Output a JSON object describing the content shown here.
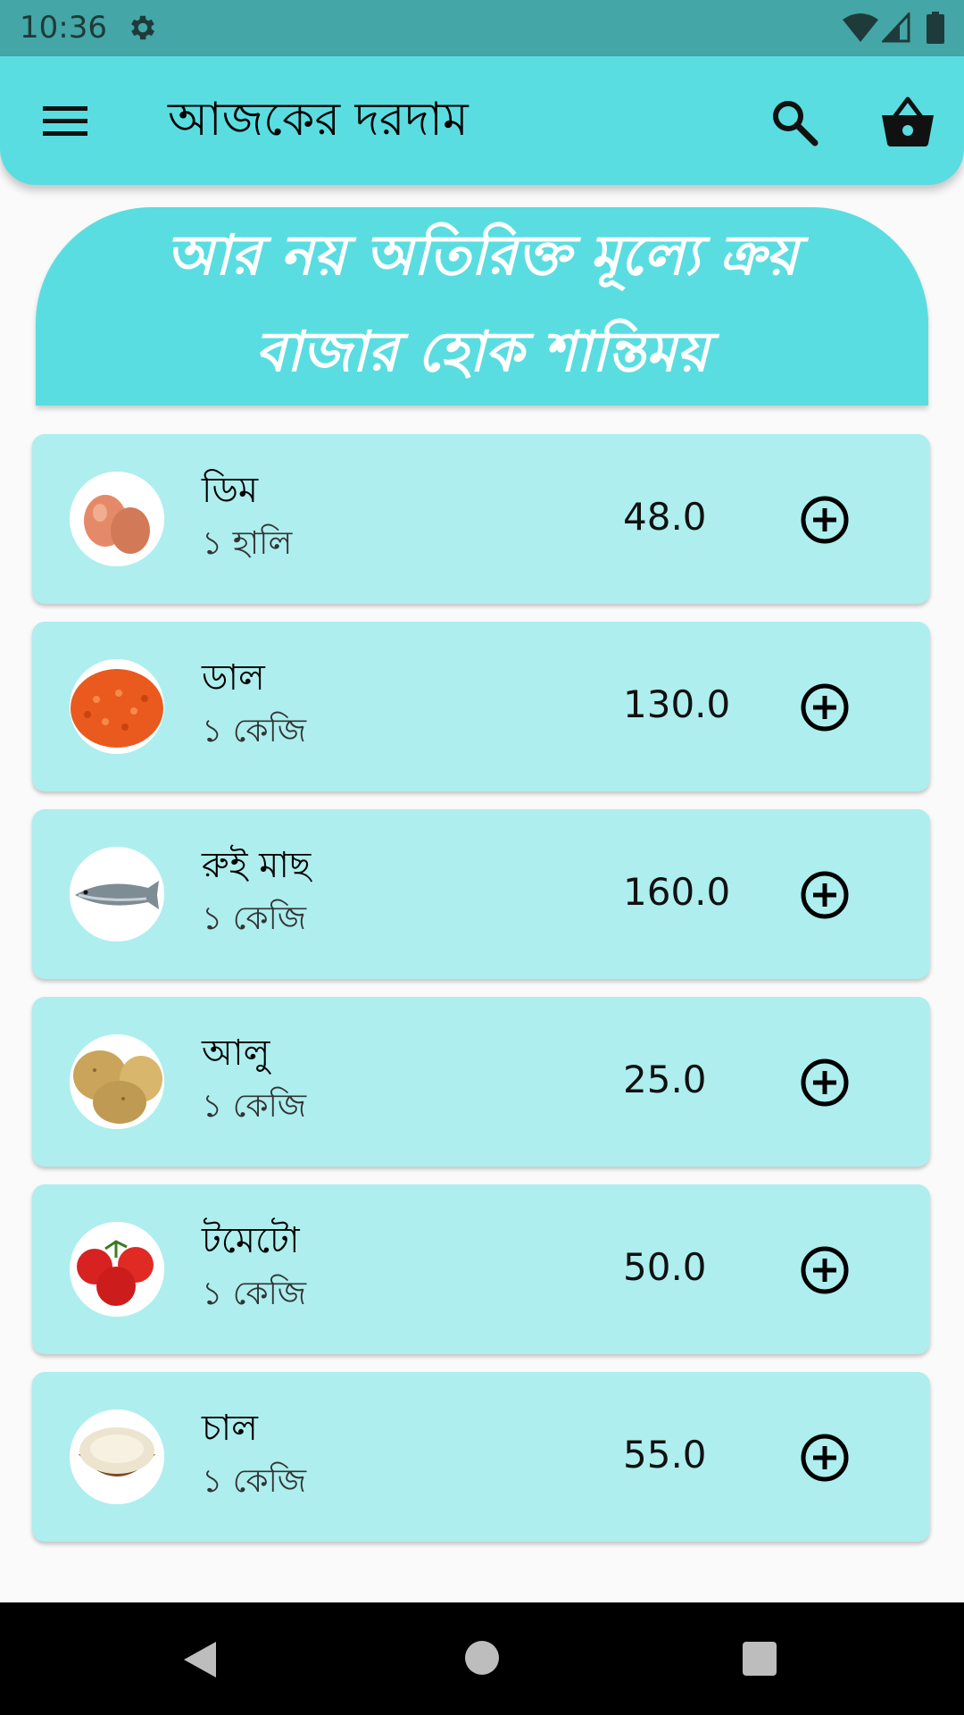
{
  "status_bar": {
    "time": "10:36"
  },
  "app_bar": {
    "title": "আজকের দরদাম"
  },
  "banner": {
    "line1": "আর নয় অতিরিক্ত মূল্যে ক্রয়",
    "line2": "বাজার হোক শান্তিময়"
  },
  "products": [
    {
      "name": "ডিম",
      "unit": "১ হালি",
      "price": "48.0",
      "icon": "eggs-image"
    },
    {
      "name": "ডাল",
      "unit": "১ কেজি",
      "price": "130.0",
      "icon": "lentils-image"
    },
    {
      "name": "রুই মাছ",
      "unit": "১ কেজি",
      "price": "160.0",
      "icon": "fish-image"
    },
    {
      "name": "আলু",
      "unit": "১ কেজি",
      "price": "25.0",
      "icon": "potatoes-image"
    },
    {
      "name": "টমেটো",
      "unit": "১ কেজি",
      "price": "50.0",
      "icon": "tomatoes-image"
    },
    {
      "name": "চাল",
      "unit": "১ কেজি",
      "price": "55.0",
      "icon": "rice-image"
    }
  ],
  "colors": {
    "status_bar": "#44a6a6",
    "app_bar": "#5adde0",
    "card": "#aeeeee",
    "background": "#fafafa"
  }
}
